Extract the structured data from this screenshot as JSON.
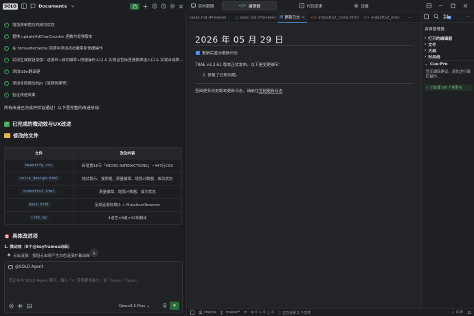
{
  "left": {
    "header": {
      "logo": "SOLO",
      "title": "Documents"
    },
    "tasks": [
      "增强表单提交的成功状态",
      "替换 updateVdCharCounter 函数为增强版本",
      "在 htmxafterSettle 回调中添加状态徽章和快捷操作",
      "实现生成按钮增强：进度环+成功徽章+快捷操作入口 & 实现音色标签搜索筛选入口 & 实现合成质量…",
      "添加i18n翻译键",
      "添加全局微动效JS（涟漪效果等）",
      "验证改进效果"
    ],
    "summary": "所有改进已完成并验证通过！以下是完整的改进总结：",
    "section1": "已完成的微动效与UX改进",
    "section2": "修改的文件",
    "table": {
      "headers": [
        "文件",
        "改动内容"
      ],
      "rows": [
        [
          "beautify.css",
          "新增第18节「MICRO-INTERACTIONS」~447行CSS"
        ],
        [
          "voice_design.html",
          "格式提示、搜索框、质量徽章、增强计数器、成功状态"
        ],
        [
          "indextts2.html",
          "质量徽章、增强计数器、成功状态"
        ],
        [
          "base.html",
          "全局涟漪效果JS + MutationObserver"
        ],
        [
          "i18n.py",
          "4语言×8键=32条翻译"
        ]
      ]
    },
    "section3": "具体改进项",
    "sub1": "1. 微动效（9个@keyframes动画）",
    "sub1_item": "点击涟漪：按钮点击时产生白色涟漪扩散动画",
    "chat": {
      "agent_label": "@SOLO Agent",
      "placeholder": "您正在与 SOLO Agent 聊天。输入「/」获取更多能力，如「/plan」「/spec」",
      "model": "Qwen3.6-Plus"
    }
  },
  "topbar": {
    "items": [
      "实时跟随",
      "编辑器",
      "代码变更",
      "设置"
    ]
  },
  "tabs": [
    "tasks.md (Preview)",
    "spec.md (Preview)",
    "更新日志",
    "indextts2_clone.html",
    "indextts2_emo"
  ],
  "release": {
    "title": "2026 年 05 月 29 日",
    "checkbox_label": "更新后显示更新日志",
    "intro": "TRAE v3.3.61 版本正式发布。以下是变更细节：",
    "item": "1. 修复了已知问题。",
    "footer_prefix": "查阅更多历史版本更新日志，请前往",
    "footer_link": "官网更新日志"
  },
  "rpanel": {
    "badge": "99",
    "explorer_title": "资源管理器",
    "rows": [
      "打开的编辑器",
      "文件",
      "大纲",
      "时间线"
    ],
    "cue_title": "Cue-Pro",
    "cue_text": "暂无编辑建议。请先进行编码操作...",
    "cue_status": "已处理 0/0 个变更点"
  },
  "statusbar": {
    "branch": "chance",
    "sync": "master*",
    "errors": "0",
    "warnings": "0",
    "info": "0",
    "analysis": "正在分析 2 个文件",
    "right": "CUE"
  }
}
